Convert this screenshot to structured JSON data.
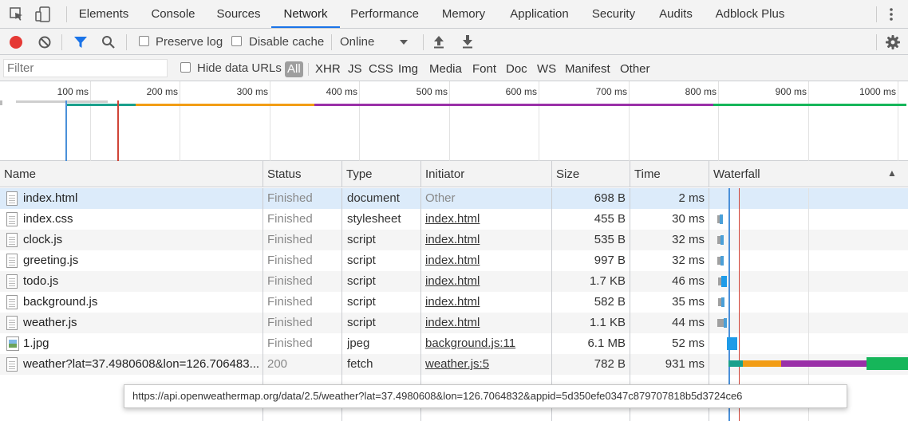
{
  "devtools": {
    "tabs": [
      "Elements",
      "Console",
      "Sources",
      "Network",
      "Performance",
      "Memory",
      "Application",
      "Security",
      "Audits",
      "Adblock Plus"
    ],
    "active_tab": "Network"
  },
  "toolbar": {
    "preserve_log": "Preserve log",
    "disable_cache": "Disable cache",
    "throttling": "Online"
  },
  "filterbar": {
    "placeholder": "Filter",
    "hide_data_urls": "Hide data URLs",
    "types": [
      "All",
      "XHR",
      "JS",
      "CSS",
      "Img",
      "Media",
      "Font",
      "Doc",
      "WS",
      "Manifest",
      "Other"
    ],
    "selected_type": "All"
  },
  "overview": {
    "ticks": [
      "100 ms",
      "200 ms",
      "300 ms",
      "400 ms",
      "500 ms",
      "600 ms",
      "700 ms",
      "800 ms",
      "900 ms",
      "1000 ms"
    ]
  },
  "table": {
    "columns": [
      "Name",
      "Status",
      "Type",
      "Initiator",
      "Size",
      "Time",
      "Waterfall"
    ],
    "sort_indicator": "▲",
    "rows": [
      {
        "name": "index.html",
        "status": "Finished",
        "type": "document",
        "initiator": "Other",
        "size": "698 B",
        "time": "2 ms",
        "icon": "document-icon"
      },
      {
        "name": "index.css",
        "status": "Finished",
        "type": "stylesheet",
        "initiator": "index.html",
        "size": "455 B",
        "time": "30 ms",
        "icon": "document-icon"
      },
      {
        "name": "clock.js",
        "status": "Finished",
        "type": "script",
        "initiator": "index.html",
        "size": "535 B",
        "time": "32 ms",
        "icon": "document-icon"
      },
      {
        "name": "greeting.js",
        "status": "Finished",
        "type": "script",
        "initiator": "index.html",
        "size": "997 B",
        "time": "32 ms",
        "icon": "document-icon"
      },
      {
        "name": "todo.js",
        "status": "Finished",
        "type": "script",
        "initiator": "index.html",
        "size": "1.7 KB",
        "time": "46 ms",
        "icon": "document-icon"
      },
      {
        "name": "background.js",
        "status": "Finished",
        "type": "script",
        "initiator": "index.html",
        "size": "582 B",
        "time": "35 ms",
        "icon": "document-icon"
      },
      {
        "name": "weather.js",
        "status": "Finished",
        "type": "script",
        "initiator": "index.html",
        "size": "1.1 KB",
        "time": "44 ms",
        "icon": "document-icon"
      },
      {
        "name": "1.jpg",
        "status": "Finished",
        "type": "jpeg",
        "initiator": "background.js:11",
        "size": "6.1 MB",
        "time": "52 ms",
        "icon": "image-icon"
      },
      {
        "name": "weather?lat=37.4980608&lon=126.706483...",
        "status": "200",
        "type": "fetch",
        "initiator": "weather.js:5",
        "size": "782 B",
        "time": "931 ms",
        "icon": "document-icon"
      }
    ]
  },
  "tooltip": "https://api.openweathermap.org/data/2.5/weather?lat=37.4980608&lon=126.7064832&appid=5d350efe0347c879707818b5d3724ce6",
  "colors": {
    "accent": "#1a73e8",
    "record": "#e53935",
    "selected_row": "#dcebfa",
    "dom_content_loaded": "#4a90d9",
    "load": "#d04437"
  }
}
